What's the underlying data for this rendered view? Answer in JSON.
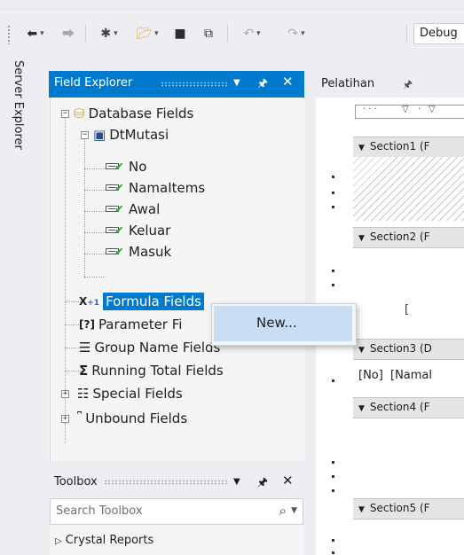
{
  "toolbar": {
    "debug_combo": "Debug"
  },
  "server_explorer": {
    "label": "Server Explorer"
  },
  "field_explorer": {
    "title": "Field Explorer",
    "tree": {
      "database_fields": "Database Fields",
      "table": "DtMutasi",
      "fields": [
        "No",
        "NamaItems",
        "Awal",
        "Keluar",
        "Masuk"
      ],
      "formula_fields": "Formula Fields",
      "parameter_fields": "Parameter Fi",
      "group_name_fields": "Group Name Fields",
      "running_total_fields": "Running Total Fields",
      "special_fields": "Special Fields",
      "unbound_fields": "Unbound Fields"
    }
  },
  "context_menu": {
    "new_label": "New..."
  },
  "toolbox": {
    "title": "Toolbox",
    "search_placeholder": "Search Toolbox",
    "category": "Crystal Reports"
  },
  "report": {
    "tab_label": "Pelatihan",
    "sections": [
      "Section1 (F",
      "Section2 (F",
      "Section3 (D",
      "Section4 (F",
      "Section5 (F"
    ],
    "field_no": "No",
    "field_nama": "Namal"
  },
  "colors": {
    "accent": "#007acc",
    "menu_highlight": "#c9def5",
    "panel": "#f5f5f5",
    "chrome": "#eeeef2"
  }
}
